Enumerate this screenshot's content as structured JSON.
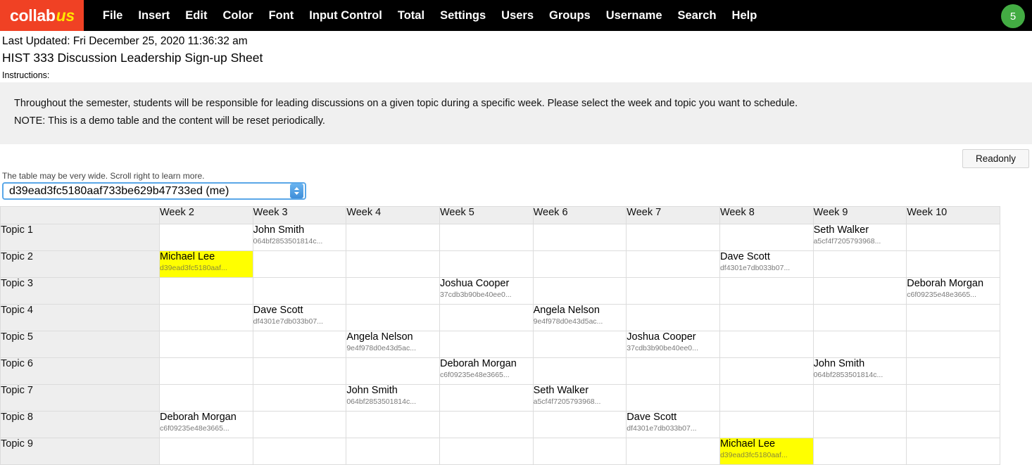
{
  "navbar": {
    "logo": {
      "primary": "collab",
      "accent": "us",
      "bg": "#f04124",
      "accent_color": "#ffe600"
    },
    "items": [
      "File",
      "Insert",
      "Edit",
      "Color",
      "Font",
      "Input Control",
      "Total",
      "Settings",
      "Users",
      "Groups",
      "Username",
      "Search",
      "Help"
    ],
    "badge": {
      "count": "5",
      "color": "#43ac43"
    }
  },
  "header": {
    "last_updated": "Last Updated: Fri December 25, 2020 11:36:32 am",
    "sheet_title": "HIST 333 Discussion Leadership Sign-up Sheet",
    "instructions_label": "Instructions:",
    "instructions_line1": "Throughout the semester, students will be responsible for leading discussions on a given topic during a specific week. Please select the week and topic you want to schedule.",
    "instructions_line2": "NOTE: This is a demo table and the content will be reset periodically."
  },
  "toolbar": {
    "readonly_label": "Readonly"
  },
  "user_select": {
    "hint": "The table may be very wide. Scroll right to learn more.",
    "selected": "d39ead3fc5180aaf733be629b47733ed (me)"
  },
  "table": {
    "corner_label": "",
    "columns": [
      "Week 2",
      "Week 3",
      "Week 4",
      "Week 5",
      "Week 6",
      "Week 7",
      "Week 8",
      "Week 9",
      "Week 10"
    ],
    "current_user_hash": "d39ead3fc5180aaf...",
    "rows": [
      {
        "topic": "Topic 1",
        "cells": [
          null,
          {
            "name": "John Smith",
            "hash": "064bf2853501814c...",
            "mine": false
          },
          null,
          null,
          null,
          null,
          null,
          {
            "name": "Seth Walker",
            "hash": "a5cf4f7205793968...",
            "mine": false
          },
          null
        ]
      },
      {
        "topic": "Topic 2",
        "cells": [
          {
            "name": "Michael Lee",
            "hash": "d39ead3fc5180aaf...",
            "mine": true
          },
          null,
          null,
          null,
          null,
          null,
          {
            "name": "Dave Scott",
            "hash": "df4301e7db033b07...",
            "mine": false
          },
          null,
          null
        ]
      },
      {
        "topic": "Topic 3",
        "cells": [
          null,
          null,
          null,
          {
            "name": "Joshua Cooper",
            "hash": "37cdb3b90be40ee0...",
            "mine": false
          },
          null,
          null,
          null,
          null,
          {
            "name": "Deborah Morgan",
            "hash": "c6f09235e48e3665...",
            "mine": false
          }
        ]
      },
      {
        "topic": "Topic 4",
        "cells": [
          null,
          {
            "name": "Dave Scott",
            "hash": "df4301e7db033b07...",
            "mine": false
          },
          null,
          null,
          {
            "name": "Angela Nelson",
            "hash": "9e4f978d0e43d5ac...",
            "mine": false
          },
          null,
          null,
          null,
          null
        ]
      },
      {
        "topic": "Topic 5",
        "cells": [
          null,
          null,
          {
            "name": "Angela Nelson",
            "hash": "9e4f978d0e43d5ac...",
            "mine": false
          },
          null,
          null,
          {
            "name": "Joshua Cooper",
            "hash": "37cdb3b90be40ee0...",
            "mine": false
          },
          null,
          null,
          null
        ]
      },
      {
        "topic": "Topic 6",
        "cells": [
          null,
          null,
          null,
          {
            "name": "Deborah Morgan",
            "hash": "c6f09235e48e3665...",
            "mine": false
          },
          null,
          null,
          null,
          {
            "name": "John Smith",
            "hash": "064bf2853501814c...",
            "mine": false
          },
          null
        ]
      },
      {
        "topic": "Topic 7",
        "cells": [
          null,
          null,
          {
            "name": "John Smith",
            "hash": "064bf2853501814c...",
            "mine": false
          },
          null,
          {
            "name": "Seth Walker",
            "hash": "a5cf4f7205793968...",
            "mine": false
          },
          null,
          null,
          null,
          null
        ]
      },
      {
        "topic": "Topic 8",
        "cells": [
          {
            "name": "Deborah Morgan",
            "hash": "c6f09235e48e3665...",
            "mine": false
          },
          null,
          null,
          null,
          null,
          {
            "name": "Dave Scott",
            "hash": "df4301e7db033b07...",
            "mine": false
          },
          null,
          null,
          null
        ]
      },
      {
        "topic": "Topic 9",
        "cells": [
          null,
          null,
          null,
          null,
          null,
          null,
          {
            "name": "Michael Lee",
            "hash": "d39ead3fc5180aaf...",
            "mine": true
          },
          null,
          null
        ]
      }
    ]
  }
}
